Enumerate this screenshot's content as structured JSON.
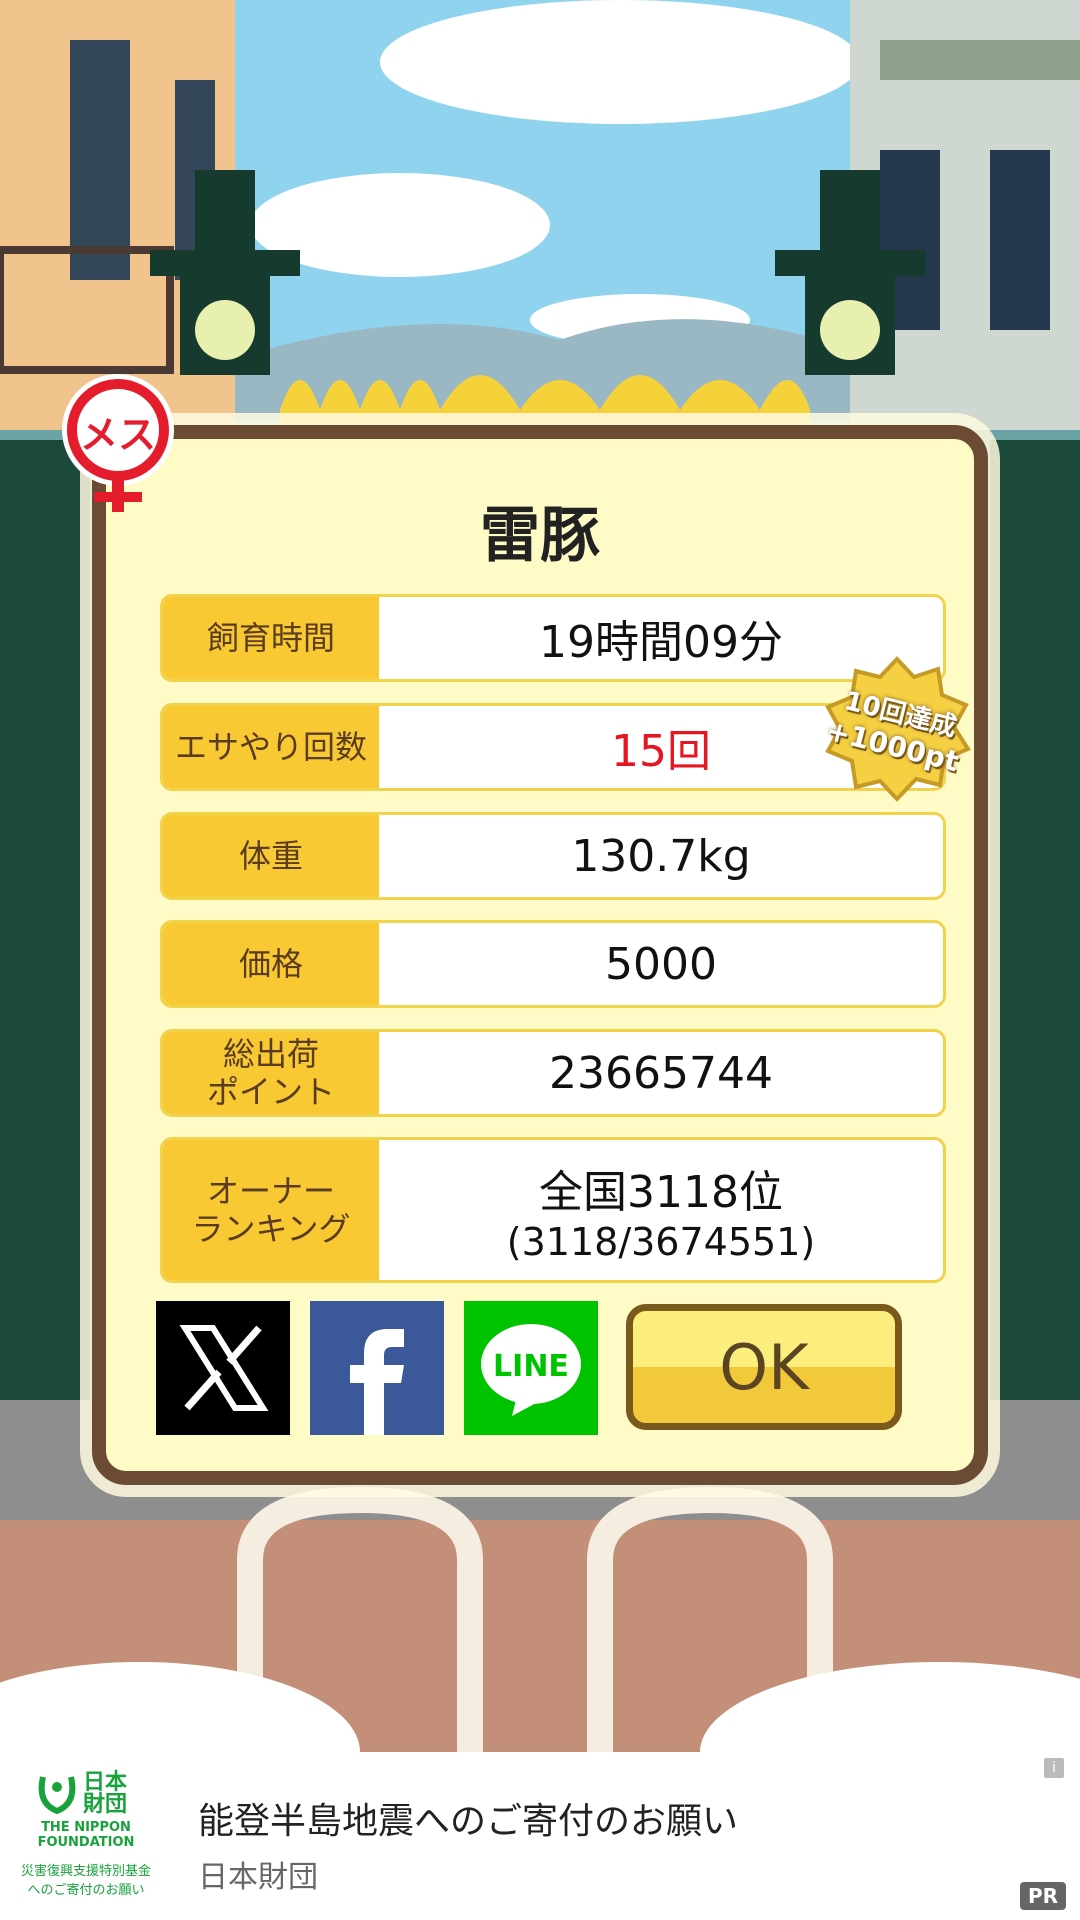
{
  "pig": {
    "name": "雷豚",
    "gender_label": "メス"
  },
  "stats": [
    {
      "label": "飼育時間",
      "value": "19時間09分"
    },
    {
      "label": "エサやり回数",
      "value": "15回"
    },
    {
      "label": "体重",
      "value": "130.7kg"
    },
    {
      "label": "価格",
      "value": "5000"
    },
    {
      "label": "総出荷\nポイント",
      "value": "23665744"
    },
    {
      "label": "オーナー\nランキング",
      "value": "全国3118位",
      "sub": "(3118/3674551)"
    }
  ],
  "badge": {
    "line1": "10回達成",
    "line2": "+1000pt"
  },
  "buttons": {
    "ok": "OK",
    "x_icon": "x-icon",
    "facebook_icon": "facebook-icon",
    "line_icon": "line-icon",
    "line_text": "LINE"
  },
  "ad": {
    "title": "能登半島地震へのご寄付のお願い",
    "sponsor": "日本財団",
    "logo_jp": "日本財団",
    "logo_en1": "THE NIPPON",
    "logo_en2": "FOUNDATION",
    "logo_caption1": "災害復興支援特別基金",
    "logo_caption2": "へのご寄付のお願い",
    "pr": "PR",
    "info": "i"
  },
  "colors": {
    "accent": "#f8c932",
    "frame": "#6b4b33",
    "panel": "#fffbc7",
    "highlight": "#e5161f"
  }
}
